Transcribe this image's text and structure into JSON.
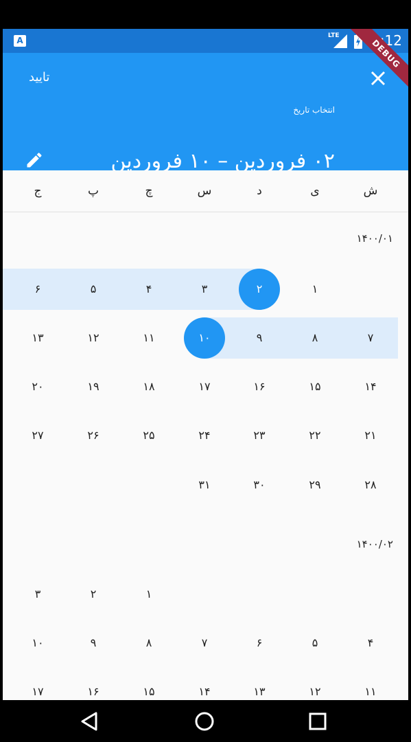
{
  "status_bar": {
    "time": "2:12",
    "network": "LTE",
    "debug_label": "DEBUG",
    "app_icon": "A"
  },
  "header": {
    "confirm_label": "تایید",
    "select_date_label": "انتخاب تاریخ",
    "range_title": "۰۲ فروردین – ۱۰ فروردین"
  },
  "weekdays": [
    "ش",
    "ی",
    "د",
    "س",
    "چ",
    "پ",
    "ج"
  ],
  "months": [
    {
      "label": "۱۴۰۰/۰۱",
      "weeks": [
        [
          "",
          "۱",
          "۲",
          "۳",
          "۴",
          "۵",
          "۶"
        ],
        [
          "۷",
          "۸",
          "۹",
          "۱۰",
          "۱۱",
          "۱۲",
          "۱۳"
        ],
        [
          "۱۴",
          "۱۵",
          "۱۶",
          "۱۷",
          "۱۸",
          "۱۹",
          "۲۰"
        ],
        [
          "۲۱",
          "۲۲",
          "۲۳",
          "۲۴",
          "۲۵",
          "۲۶",
          "۲۷"
        ],
        [
          "۲۸",
          "۲۹",
          "۳۰",
          "۳۱",
          "",
          "",
          ""
        ]
      ]
    },
    {
      "label": "۱۴۰۰/۰۲",
      "weeks": [
        [
          "",
          "",
          "",
          "",
          "۱",
          "۲",
          "۳"
        ],
        [
          "۴",
          "۵",
          "۶",
          "۷",
          "۸",
          "۹",
          "۱۰"
        ],
        [
          "۱۱",
          "۱۲",
          "۱۳",
          "۱۴",
          "۱۵",
          "۱۶",
          "۱۷"
        ]
      ]
    }
  ],
  "selection": {
    "start": "۲",
    "end": "۱۰"
  },
  "colors": {
    "primary": "#2196f3",
    "status": "#1976d2",
    "range": "#ddecfb",
    "debug": "#a0283f"
  },
  "nav": {
    "icons": [
      "back-icon",
      "home-icon",
      "recents-icon"
    ]
  }
}
